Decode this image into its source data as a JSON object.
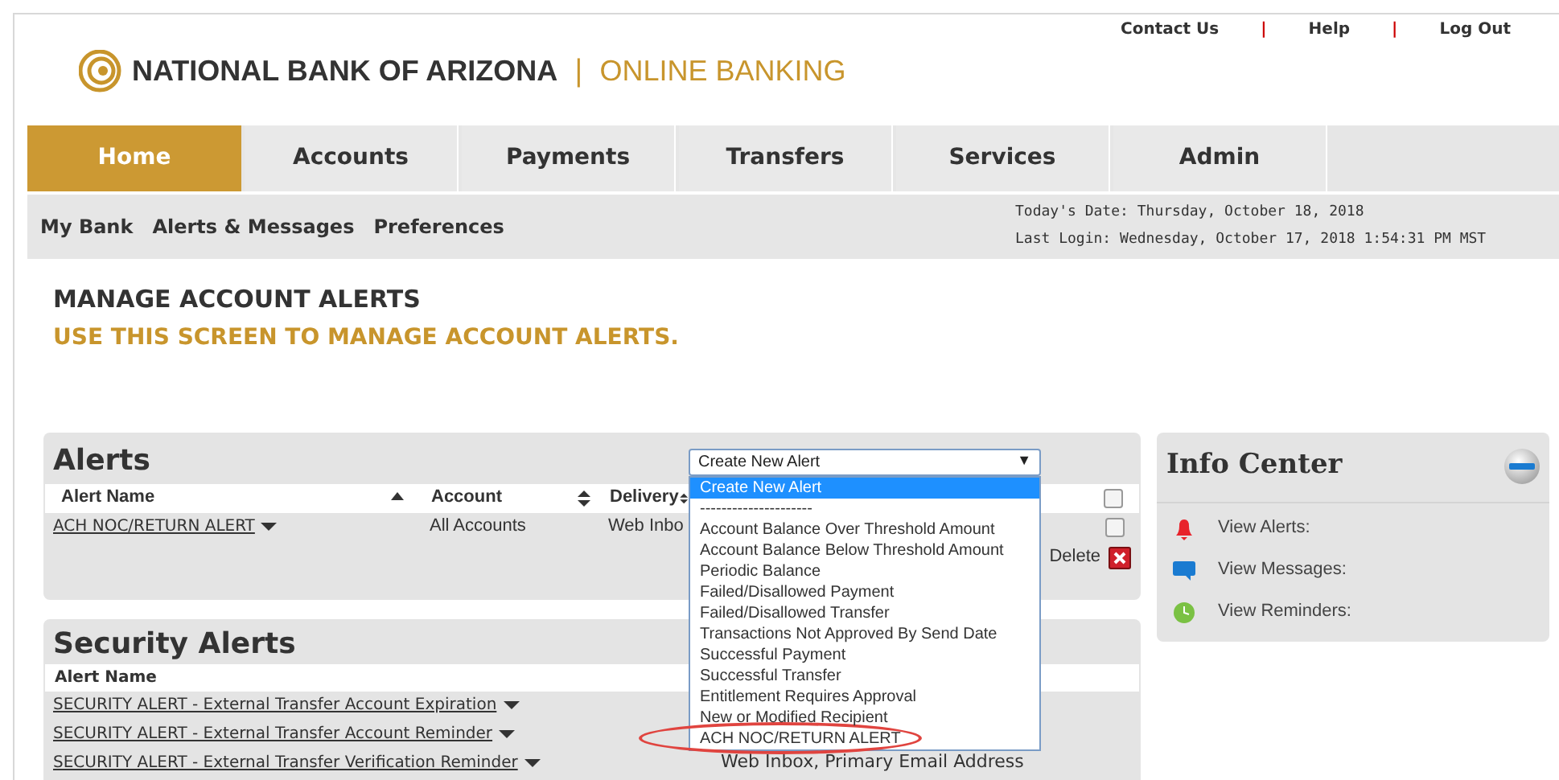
{
  "top_links": {
    "items": [
      "Contact Us",
      "Help",
      "Log Out"
    ],
    "separator": "|"
  },
  "logo": {
    "brand": "NATIONAL BANK OF ARIZONA",
    "divider": "|",
    "product": "ONLINE BANKING"
  },
  "nav_tabs": [
    {
      "label": "Home",
      "selected": true
    },
    {
      "label": "Accounts",
      "selected": false
    },
    {
      "label": "Payments",
      "selected": false
    },
    {
      "label": "Transfers",
      "selected": false
    },
    {
      "label": "Services",
      "selected": false
    },
    {
      "label": "Admin",
      "selected": false
    }
  ],
  "sub_nav": {
    "items": [
      "My Bank",
      "Alerts & Messages",
      "Preferences"
    ],
    "todays_date": "Today's Date: Thursday, October 18, 2018",
    "last_login": "Last Login: Wednesday, October 17, 2018 1:54:31 PM MST"
  },
  "page": {
    "title": "MANAGE ACCOUNT ALERTS",
    "subtitle": "USE THIS SCREEN TO MANAGE ACCOUNT ALERTS."
  },
  "alerts": {
    "title": "Alerts",
    "columns": [
      {
        "label": "Alert Name",
        "kind": "sorted"
      },
      {
        "label": "Account",
        "kind": "sortable"
      },
      {
        "label": "Delivery",
        "kind": "sortable"
      }
    ],
    "header_checkbox": {
      "checked": false
    },
    "rows": [
      {
        "name": "ACH NOC/RETURN ALERT",
        "account": "All Accounts",
        "delivery": "Web Inbo",
        "checked": false
      }
    ],
    "delete_label": "Delete",
    "select": {
      "value": "Create New Alert",
      "arrow": "▼"
    },
    "dropdown": [
      {
        "label": "Create New Alert",
        "selected": true,
        "circled": false
      },
      {
        "label": "---------------------",
        "selected": false,
        "circled": false
      },
      {
        "label": "Account Balance Over Threshold Amount",
        "selected": false,
        "circled": false
      },
      {
        "label": "Account Balance Below Threshold Amount",
        "selected": false,
        "circled": false
      },
      {
        "label": "Periodic Balance",
        "selected": false,
        "circled": false
      },
      {
        "label": "Failed/Disallowed Payment",
        "selected": false,
        "circled": false
      },
      {
        "label": "Failed/Disallowed Transfer",
        "selected": false,
        "circled": false
      },
      {
        "label": "Transactions Not Approved By Send Date",
        "selected": false,
        "circled": false
      },
      {
        "label": "Successful Payment",
        "selected": false,
        "circled": false
      },
      {
        "label": "Successful Transfer",
        "selected": false,
        "circled": false
      },
      {
        "label": "Entitlement Requires Approval",
        "selected": false,
        "circled": false
      },
      {
        "label": "New or Modified Recipient",
        "selected": false,
        "circled": false
      },
      {
        "label": "ACH NOC/RETURN ALERT",
        "selected": false,
        "circled": true
      }
    ]
  },
  "security_alerts": {
    "title": "Security Alerts",
    "column": "Alert Name",
    "rows": [
      {
        "name": "SECURITY ALERT - External Transfer Account Expiration"
      },
      {
        "name": "SECURITY ALERT - External Transfer Account Reminder"
      },
      {
        "name": "SECURITY ALERT - External Transfer Verification Reminder",
        "delivery": "Web Inbox, Primary Email Address"
      }
    ]
  },
  "info_center": {
    "title": "Info Center",
    "items": [
      {
        "kind": "bell",
        "label": "View Alerts:"
      },
      {
        "kind": "message",
        "label": "View Messages:"
      },
      {
        "kind": "clock",
        "label": "View Reminders:"
      }
    ]
  }
}
